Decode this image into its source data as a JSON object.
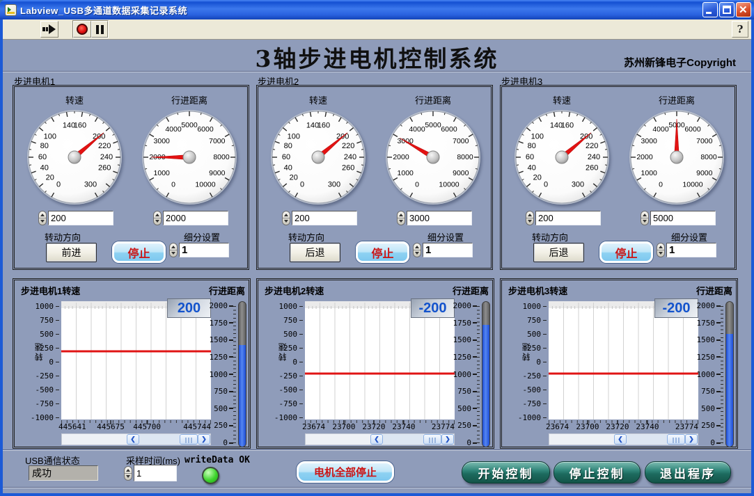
{
  "window": {
    "title": "Labview_USB多通道数据采集记录系统"
  },
  "toolbar": {
    "run_icon": "run-arrow",
    "stop_icon": "stop-octagon",
    "pause_icon": "pause-bars",
    "help_label": "?"
  },
  "header": {
    "title": "3轴步进电机控制系统",
    "copyright": "苏州新锋电子Copyright"
  },
  "gauge_scales": {
    "speed": {
      "min": 0,
      "max": 300,
      "major": 20,
      "minor": 10,
      "labels": [
        0,
        20,
        40,
        60,
        80,
        100,
        140,
        160,
        200,
        220,
        240,
        260,
        300
      ]
    },
    "distance": {
      "min": 0,
      "max": 10000,
      "major": 1000,
      "minor": 500,
      "labels": [
        0,
        1000,
        2000,
        3000,
        4000,
        5000,
        6000,
        7000,
        8000,
        9000,
        10000
      ]
    }
  },
  "motors": [
    {
      "panel_label": "步进电机1",
      "speed_label": "转速",
      "distance_label": "行进距离",
      "speed_value": 200,
      "speed_input": "200",
      "distance_value": 2000,
      "distance_input": "2000",
      "direction_label": "转动方向",
      "direction_button": "前进",
      "stop_button": "停止",
      "subdiv_label": "细分设置",
      "subdiv_value": "1"
    },
    {
      "panel_label": "步进电机2",
      "speed_label": "转速",
      "distance_label": "行进距离",
      "speed_value": 200,
      "speed_input": "200",
      "distance_value": 3000,
      "distance_input": "3000",
      "direction_label": "转动方向",
      "direction_button": "后退",
      "stop_button": "停止",
      "subdiv_label": "细分设置",
      "subdiv_value": "1"
    },
    {
      "panel_label": "步进电机3",
      "speed_label": "转速",
      "distance_label": "行进距离",
      "speed_value": 200,
      "speed_input": "200",
      "distance_value": 5000,
      "distance_input": "5000",
      "direction_label": "转动方向",
      "direction_button": "后退",
      "stop_button": "停止",
      "subdiv_label": "细分设置",
      "subdiv_value": "1"
    }
  ],
  "chart_axis": {
    "ylabel": "转速",
    "y_ticks": [
      1000,
      750,
      500,
      250,
      0,
      -250,
      -500,
      -750,
      -1000
    ],
    "y_min": -1000,
    "y_max": 1000,
    "slider_label": "行进距离",
    "slider_ticks": [
      2000,
      1750,
      1500,
      1250,
      1000,
      750,
      500,
      250,
      0
    ],
    "slider_max": 2000
  },
  "charts": [
    {
      "title": "步进电机1转速",
      "display": "200",
      "line_value": 200,
      "x_ticks": [
        445641,
        445675,
        445700,
        445744
      ],
      "slider_value": 1400
    },
    {
      "title": "步进电机2转速",
      "display": "-200",
      "line_value": -200,
      "x_ticks": [
        23674,
        23700,
        23720,
        23740,
        23774
      ],
      "slider_value": 1700
    },
    {
      "title": "步进电机3转速",
      "display": "-200",
      "line_value": -200,
      "x_ticks": [
        23674,
        23700,
        23720,
        23740,
        23774
      ],
      "slider_value": 1560
    }
  ],
  "chart_data": [
    {
      "type": "line",
      "title": "步进电机1转速",
      "ylabel": "转速",
      "ylim": [
        -1000,
        1000
      ],
      "x_range": [
        445641,
        445744
      ],
      "series": [
        {
          "name": "转速",
          "constant_value": 200
        }
      ],
      "indicator_value": 200,
      "distance_slider": {
        "label": "行进距离",
        "range": [
          0,
          2000
        ],
        "value": 1400
      }
    },
    {
      "type": "line",
      "title": "步进电机2转速",
      "ylabel": "转速",
      "ylim": [
        -1000,
        1000
      ],
      "x_range": [
        23674,
        23774
      ],
      "series": [
        {
          "name": "转速",
          "constant_value": -200
        }
      ],
      "indicator_value": -200,
      "distance_slider": {
        "label": "行进距离",
        "range": [
          0,
          2000
        ],
        "value": 1700
      }
    },
    {
      "type": "line",
      "title": "步进电机3转速",
      "ylabel": "转速",
      "ylim": [
        -1000,
        1000
      ],
      "x_range": [
        23674,
        23774
      ],
      "series": [
        {
          "name": "转速",
          "constant_value": -200
        }
      ],
      "indicator_value": -200,
      "distance_slider": {
        "label": "行进距离",
        "range": [
          0,
          2000
        ],
        "value": 1560
      }
    }
  ],
  "footer": {
    "usb_label": "USB通信状态",
    "usb_value": "成功",
    "sample_label": "采样时间(ms)",
    "sample_value": "1",
    "write_label": "writeData OK",
    "stop_all_button": "电机全部停止",
    "start_button": "开始控制",
    "stop_button": "停止控制",
    "exit_button": "退出程序"
  },
  "colors": {
    "panel_bg": "#8f9cba",
    "needle_red": "#e41212",
    "line_red": "#e01414",
    "display_blue": "#1353cc",
    "slider_blue": "#2a5ce0",
    "led_green": "#3fd42e",
    "button_teal": "#2e8478",
    "stop_text_red": "#cc1414"
  }
}
